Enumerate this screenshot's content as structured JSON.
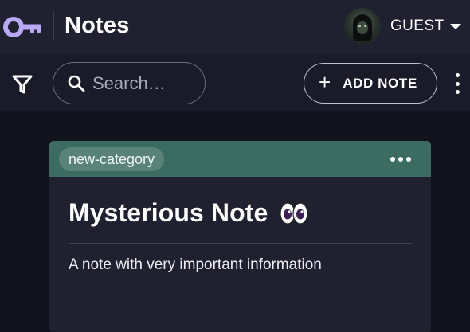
{
  "app": {
    "title": "Notes",
    "logo_icon": "key-icon",
    "accent_color": "#b9a8f5"
  },
  "user": {
    "name": "GUEST",
    "avatar_icon": "hooded-figure-avatar"
  },
  "toolbar": {
    "filter_icon": "filter-icon",
    "search_placeholder": "Search…",
    "add_note_label": "ADD NOTE",
    "more_icon": "vertical-dots-icon"
  },
  "note": {
    "category": "new-category",
    "title": "Mysterious Note",
    "title_emoji": "eyes-emoji",
    "body": "A note with very important information",
    "header_color": "#3c6b61"
  }
}
